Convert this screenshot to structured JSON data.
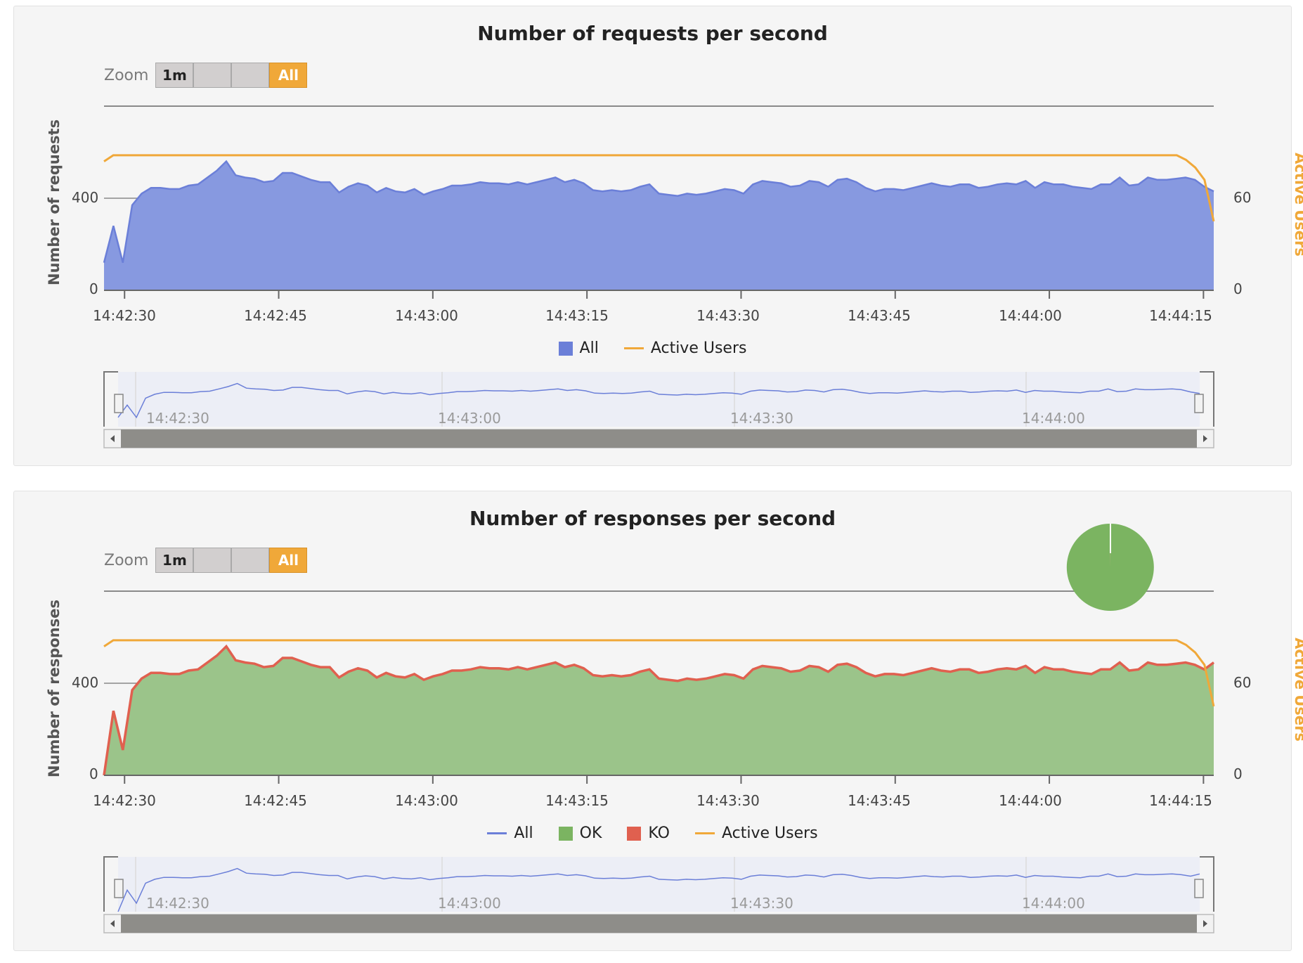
{
  "colors": {
    "all": "#6b7fd8",
    "all_fill": "#8799e0",
    "ok": "#7bb461",
    "ok_fill": "#9bc48a",
    "ko": "#e0604f",
    "active_users": "#f0a839",
    "nav_line": "#6b7fd8"
  },
  "chart_data": [
    {
      "type": "area",
      "title": "Number of requests per second",
      "ylabel": "Number of requests",
      "y2label": "Active Users",
      "zoom": {
        "label": "Zoom",
        "buttons": [
          "1m",
          "",
          "",
          "All"
        ],
        "selected": "All"
      },
      "x_start": "14:42:28",
      "x_end": "14:44:16",
      "x_ticks": [
        "14:42:30",
        "14:42:45",
        "14:43:00",
        "14:43:15",
        "14:43:30",
        "14:43:45",
        "14:44:00",
        "14:44:15"
      ],
      "y_ticks": [
        "0",
        "400"
      ],
      "y2_ticks": [
        "0",
        "60"
      ],
      "ylim": [
        0,
        800
      ],
      "y2lim": [
        0,
        120
      ],
      "grid": true,
      "legend_position": "bottom-center",
      "legend": [
        "All",
        "Active Users"
      ],
      "navigator_ticks": [
        "14:42:30",
        "14:43:00",
        "14:43:30",
        "14:44:00"
      ],
      "series": [
        {
          "name": "All",
          "values": [
            120,
            280,
            120,
            370,
            420,
            445,
            445,
            440,
            440,
            455,
            460,
            490,
            520,
            560,
            500,
            490,
            485,
            470,
            475,
            510,
            510,
            495,
            480,
            470,
            470,
            425,
            450,
            465,
            455,
            425,
            445,
            430,
            425,
            440,
            415,
            430,
            440,
            455,
            455,
            460,
            470,
            465,
            465,
            460,
            470,
            460,
            470,
            480,
            490,
            470,
            480,
            465,
            435,
            430,
            435,
            430,
            435,
            450,
            460,
            420,
            415,
            410,
            420,
            415,
            420,
            430,
            440,
            435,
            420,
            460,
            475,
            470,
            465,
            450,
            455,
            475,
            470,
            450,
            480,
            485,
            470,
            445,
            430,
            440,
            440,
            435,
            445,
            455,
            465,
            455,
            450,
            460,
            460,
            445,
            450,
            460,
            465,
            460,
            475,
            445,
            470,
            460,
            460,
            450,
            445,
            440,
            460,
            460,
            490,
            455,
            460,
            490,
            480,
            480,
            485,
            490,
            480,
            450,
            430
          ]
        },
        {
          "name": "Active Users",
          "axis": "right",
          "values": [
            84,
            88,
            88,
            88,
            88,
            88,
            88,
            88,
            88,
            88,
            88,
            88,
            88,
            88,
            88,
            88,
            88,
            88,
            88,
            88,
            88,
            88,
            88,
            88,
            88,
            88,
            88,
            88,
            88,
            88,
            88,
            88,
            88,
            88,
            88,
            88,
            88,
            88,
            88,
            88,
            88,
            88,
            88,
            88,
            88,
            88,
            88,
            88,
            88,
            88,
            88,
            88,
            88,
            88,
            88,
            88,
            88,
            88,
            88,
            88,
            88,
            88,
            88,
            88,
            88,
            88,
            88,
            88,
            88,
            88,
            88,
            88,
            88,
            88,
            88,
            88,
            88,
            88,
            88,
            88,
            88,
            88,
            88,
            88,
            88,
            88,
            88,
            88,
            88,
            88,
            88,
            88,
            88,
            88,
            88,
            88,
            88,
            88,
            88,
            88,
            88,
            88,
            88,
            88,
            88,
            88,
            88,
            88,
            88,
            88,
            88,
            88,
            88,
            88,
            88,
            88,
            88,
            85,
            80,
            72,
            45
          ]
        }
      ]
    },
    {
      "type": "area",
      "title": "Number of responses per second",
      "ylabel": "Number of responses",
      "y2label": "Active Users",
      "zoom": {
        "label": "Zoom",
        "buttons": [
          "1m",
          "",
          "",
          "All"
        ],
        "selected": "All"
      },
      "x_start": "14:42:28",
      "x_end": "14:44:16",
      "x_ticks": [
        "14:42:30",
        "14:42:45",
        "14:43:00",
        "14:43:15",
        "14:43:30",
        "14:43:45",
        "14:44:00",
        "14:44:15"
      ],
      "y_ticks": [
        "0",
        "400"
      ],
      "y2_ticks": [
        "0",
        "60"
      ],
      "ylim": [
        0,
        800
      ],
      "y2lim": [
        0,
        120
      ],
      "grid": true,
      "legend_position": "bottom-center",
      "legend": [
        "All",
        "OK",
        "KO",
        "Active Users"
      ],
      "navigator_ticks": [
        "14:42:30",
        "14:43:00",
        "14:43:30",
        "14:44:00"
      ],
      "pie": [
        {
          "name": "OK",
          "value": 99.9
        },
        {
          "name": "KO",
          "value": 0.1
        }
      ],
      "series": [
        {
          "name": "OK",
          "values": [
            0,
            280,
            110,
            370,
            420,
            445,
            445,
            440,
            440,
            455,
            460,
            490,
            520,
            560,
            500,
            490,
            485,
            470,
            475,
            510,
            510,
            495,
            480,
            470,
            470,
            425,
            450,
            465,
            455,
            425,
            445,
            430,
            425,
            440,
            415,
            430,
            440,
            455,
            455,
            460,
            470,
            465,
            465,
            460,
            470,
            460,
            470,
            480,
            490,
            470,
            480,
            465,
            435,
            430,
            435,
            430,
            435,
            450,
            460,
            420,
            415,
            410,
            420,
            415,
            420,
            430,
            440,
            435,
            420,
            460,
            475,
            470,
            465,
            450,
            455,
            475,
            470,
            450,
            480,
            485,
            470,
            445,
            430,
            440,
            440,
            435,
            445,
            455,
            465,
            455,
            450,
            460,
            460,
            445,
            450,
            460,
            465,
            460,
            475,
            445,
            470,
            460,
            460,
            450,
            445,
            440,
            460,
            460,
            490,
            455,
            460,
            490,
            480,
            480,
            485,
            490,
            480,
            460,
            490
          ]
        },
        {
          "name": "Active Users",
          "axis": "right",
          "values": [
            84,
            88,
            88,
            88,
            88,
            88,
            88,
            88,
            88,
            88,
            88,
            88,
            88,
            88,
            88,
            88,
            88,
            88,
            88,
            88,
            88,
            88,
            88,
            88,
            88,
            88,
            88,
            88,
            88,
            88,
            88,
            88,
            88,
            88,
            88,
            88,
            88,
            88,
            88,
            88,
            88,
            88,
            88,
            88,
            88,
            88,
            88,
            88,
            88,
            88,
            88,
            88,
            88,
            88,
            88,
            88,
            88,
            88,
            88,
            88,
            88,
            88,
            88,
            88,
            88,
            88,
            88,
            88,
            88,
            88,
            88,
            88,
            88,
            88,
            88,
            88,
            88,
            88,
            88,
            88,
            88,
            88,
            88,
            88,
            88,
            88,
            88,
            88,
            88,
            88,
            88,
            88,
            88,
            88,
            88,
            88,
            88,
            88,
            88,
            88,
            88,
            88,
            88,
            88,
            88,
            88,
            88,
            88,
            88,
            88,
            88,
            88,
            88,
            88,
            88,
            88,
            88,
            85,
            80,
            72,
            45
          ]
        }
      ]
    }
  ]
}
